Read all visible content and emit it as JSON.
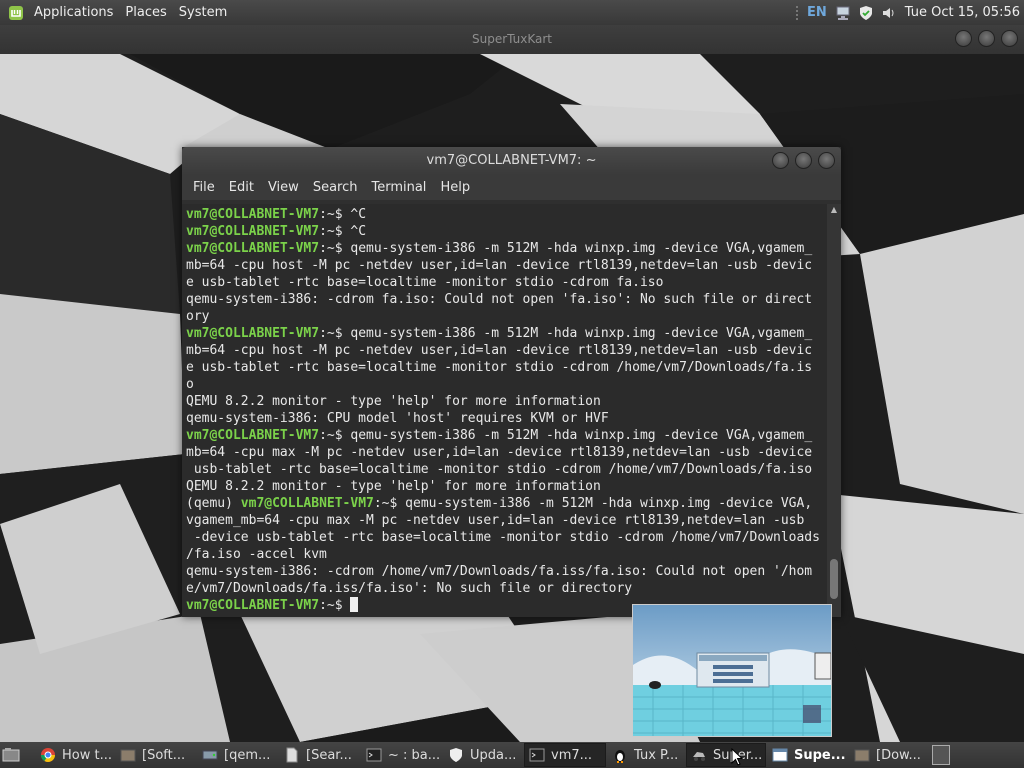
{
  "top_panel": {
    "menu": [
      "Applications",
      "Places",
      "System"
    ],
    "keyboard_layout": "EN",
    "clock": "Tue Oct 15, 05:56"
  },
  "background_window": {
    "title": "SuperTuxKart"
  },
  "terminal": {
    "title": "vm7@COLLABNET-VM7: ~",
    "menu": [
      "File",
      "Edit",
      "View",
      "Search",
      "Terminal",
      "Help"
    ],
    "prompt": "vm7@COLLABNET-VM7",
    "lines": [
      {
        "prompt": "vm7@COLLABNET-VM7",
        "text": ":~$ ^C"
      },
      {
        "prompt": "vm7@COLLABNET-VM7",
        "text": ":~$ ^C"
      },
      {
        "prompt": "vm7@COLLABNET-VM7",
        "text": ":~$ qemu-system-i386 -m 512M -hda winxp.img -device VGA,vgamem_"
      },
      {
        "text": "mb=64 -cpu host -M pc -netdev user,id=lan -device rtl8139,netdev=lan -usb -devic"
      },
      {
        "text": "e usb-tablet -rtc base=localtime -monitor stdio -cdrom fa.iso"
      },
      {
        "text": "qemu-system-i386: -cdrom fa.iso: Could not open 'fa.iso': No such file or direct"
      },
      {
        "text": "ory"
      },
      {
        "prompt": "vm7@COLLABNET-VM7",
        "text": ":~$ qemu-system-i386 -m 512M -hda winxp.img -device VGA,vgamem_"
      },
      {
        "text": "mb=64 -cpu host -M pc -netdev user,id=lan -device rtl8139,netdev=lan -usb -devic"
      },
      {
        "text": "e usb-tablet -rtc base=localtime -monitor stdio -cdrom /home/vm7/Downloads/fa.is"
      },
      {
        "text": "o"
      },
      {
        "text": "QEMU 8.2.2 monitor - type 'help' for more information"
      },
      {
        "text": "qemu-system-i386: CPU model 'host' requires KVM or HVF"
      },
      {
        "prompt": "vm7@COLLABNET-VM7",
        "text": ":~$ qemu-system-i386 -m 512M -hda winxp.img -device VGA,vgamem_"
      },
      {
        "text": "mb=64 -cpu max -M pc -netdev user,id=lan -device rtl8139,netdev=lan -usb -device"
      },
      {
        "text": " usb-tablet -rtc base=localtime -monitor stdio -cdrom /home/vm7/Downloads/fa.iso"
      },
      {
        "text": "QEMU 8.2.2 monitor - type 'help' for more information"
      },
      {
        "pre": "(qemu) ",
        "prompt": "vm7@COLLABNET-VM7",
        "text": ":~$ qemu-system-i386 -m 512M -hda winxp.img -device VGA,"
      },
      {
        "text": "vgamem_mb=64 -cpu max -M pc -netdev user,id=lan -device rtl8139,netdev=lan -usb"
      },
      {
        "text": " -device usb-tablet -rtc base=localtime -monitor stdio -cdrom /home/vm7/Downloads"
      },
      {
        "text": "/fa.iso -accel kvm"
      },
      {
        "text": "qemu-system-i386: -cdrom /home/vm7/Downloads/fa.iss/fa.iso: Could not open '/hom"
      },
      {
        "text": "e/vm7/Downloads/fa.iss/fa.iso': No such file or directory"
      },
      {
        "prompt": "vm7@COLLABNET-VM7",
        "text": ":~$ ",
        "cursor": true
      }
    ]
  },
  "taskbar": {
    "items": [
      {
        "label": "How t...",
        "icon": "chrome-icon"
      },
      {
        "label": "[Soft...",
        "icon": "folder-icon"
      },
      {
        "label": "[qem...",
        "icon": "drive-icon"
      },
      {
        "label": "[Sear...",
        "icon": "document-icon"
      },
      {
        "label": "~ : ba...",
        "icon": "terminal-icon"
      },
      {
        "label": "Upda...",
        "icon": "shield-icon"
      },
      {
        "label": "vm7...",
        "icon": "terminal-icon",
        "active": true
      },
      {
        "label": "Tux P...",
        "icon": "tux-icon"
      },
      {
        "label": "Super...",
        "icon": "kart-icon",
        "active": true
      },
      {
        "label": "Supe...",
        "icon": "window-icon",
        "bold": true
      },
      {
        "label": "[Dow...",
        "icon": "folder-icon"
      }
    ]
  },
  "colors": {
    "prompt": "#7bd24a",
    "terminal_bg": "#2b2b2b",
    "panel_bg": "#3d3d3d"
  }
}
